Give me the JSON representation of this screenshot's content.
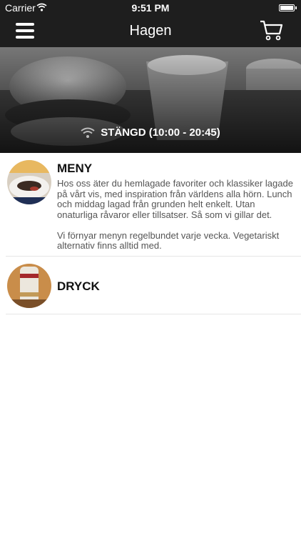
{
  "status_bar": {
    "carrier": "Carrier",
    "time": "9:51 PM",
    "wifi_icon": "wifi-icon",
    "battery_icon": "battery-icon"
  },
  "nav_bar": {
    "title": "Hagen",
    "menu_icon": "hamburger-menu-icon",
    "cart_icon": "shopping-cart-icon"
  },
  "hero": {
    "status_icon": "wifi-icon",
    "status_text": "STÄNGD (10:00 - 20:45)"
  },
  "sections": [
    {
      "title": "MENY",
      "description": "Hos oss äter du hemlagade favoriter och klassiker lagade på vårt vis, med inspiration från världens alla hörn. Lunch och middag lagad från grunden helt enkelt. Utan onaturliga råvaror eller tillsatser. Så som vi gillar det.\n\nVi förnyar menyn regelbundet varje vecka. Vegetariskt alternativ finns alltid med."
    },
    {
      "title": "DRYCK"
    }
  ],
  "colors": {
    "bar_background": "#1e1e1e",
    "text_primary": "#111111",
    "text_secondary": "#555555",
    "divider": "#e6e6e6"
  }
}
